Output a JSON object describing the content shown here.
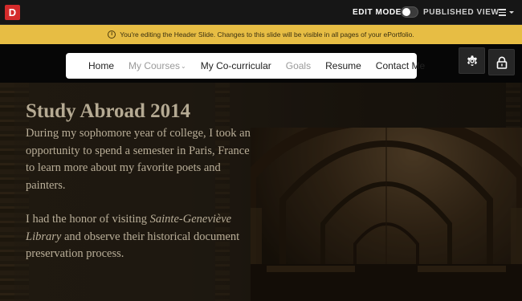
{
  "topbar": {
    "logo_letter": "D",
    "edit_mode_label": "EDIT MODE",
    "published_view_label": "PUBLISHED VIEW",
    "toggle_state": "off"
  },
  "banner": {
    "icon": "info-icon",
    "text": "You're editing the Header Slide. Changes to this slide will be visible in all pages of your ePortfolio.",
    "color": "#e7bd44"
  },
  "nav": {
    "items": [
      {
        "label": "Home"
      },
      {
        "label": "My Courses",
        "dropdown": true
      },
      {
        "label": "My Co-curricular"
      },
      {
        "label": "Goals"
      },
      {
        "label": "Resume"
      },
      {
        "label": "Contact Me"
      }
    ]
  },
  "tools": {
    "settings_icon": "gear-icon",
    "lock_icon": "lock-icon"
  },
  "hero": {
    "title": "Study Abroad 2014",
    "paragraph1": "During my sophomore year of college, I took an opportunity to spend a semester in Paris, France to learn more about my favorite poets and painters.",
    "p2_before": "I had the honor of visiting ",
    "p2_em": "Sainte-Geneviève Library",
    "p2_after": " and observe their historical document preservation process."
  }
}
